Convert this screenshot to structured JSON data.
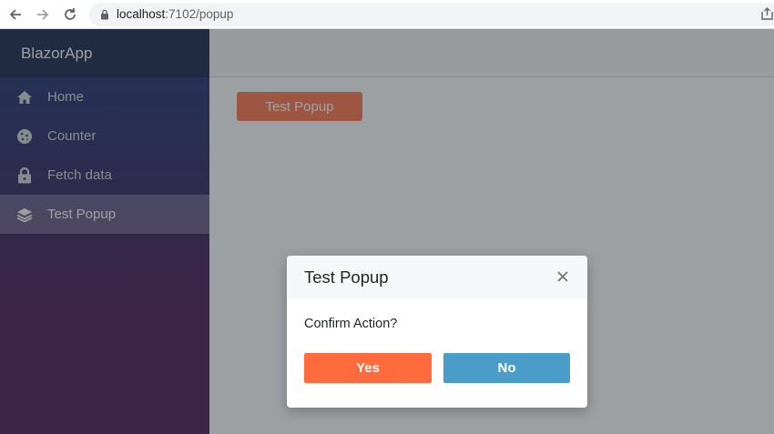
{
  "browser": {
    "url_host": "localhost",
    "url_path": ":7102/popup"
  },
  "sidebar": {
    "brand": "BlazorApp",
    "items": [
      {
        "label": "Home",
        "icon": "home-icon",
        "active": false
      },
      {
        "label": "Counter",
        "icon": "cookie-icon",
        "active": false
      },
      {
        "label": "Fetch data",
        "icon": "lock-icon",
        "active": false
      },
      {
        "label": "Test Popup",
        "icon": "layers-icon",
        "active": true
      }
    ]
  },
  "main": {
    "test_button_label": "Test Popup"
  },
  "modal": {
    "title": "Test Popup",
    "message": "Confirm Action?",
    "yes_label": "Yes",
    "no_label": "No"
  },
  "colors": {
    "accent_orange": "#ff6b3d",
    "accent_blue": "#4a9cc9",
    "sidebar_top": "#052767",
    "sidebar_bottom": "#3a0647"
  }
}
